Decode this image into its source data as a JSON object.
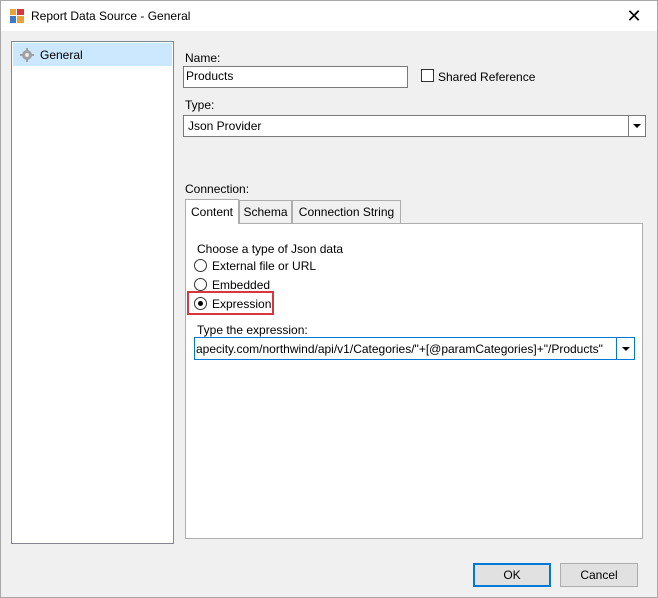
{
  "window": {
    "title": "Report Data Source - General",
    "close_glyph": "✕",
    "icon": "report-data-source-icon"
  },
  "nav": {
    "items": [
      {
        "label": "General",
        "icon": "gear-icon",
        "selected": true
      }
    ]
  },
  "form": {
    "name_label": "Name:",
    "name_value": "Products",
    "shared_reference_label": "Shared Reference",
    "shared_reference_checked": false,
    "type_label": "Type:",
    "type_value": "Json Provider",
    "connection_label": "Connection:"
  },
  "tabs": [
    {
      "label": "Content",
      "active": true
    },
    {
      "label": "Schema",
      "active": false
    },
    {
      "label": "Connection String",
      "active": false
    }
  ],
  "content": {
    "choose_label": "Choose a type of Json data",
    "options": [
      {
        "label": "External file or URL",
        "checked": false
      },
      {
        "label": "Embedded",
        "checked": false
      },
      {
        "label": "Expression",
        "checked": true
      }
    ],
    "expression_label": "Type the expression:",
    "expression_value": "apecity.com/northwind/api/v1/Categories/\"+[@paramCategories]+\"/Products\""
  },
  "buttons": {
    "ok": "OK",
    "cancel": "Cancel"
  },
  "colors": {
    "selection": "#cce8ff",
    "focus": "#0078d7",
    "highlight": "#d9363e"
  }
}
